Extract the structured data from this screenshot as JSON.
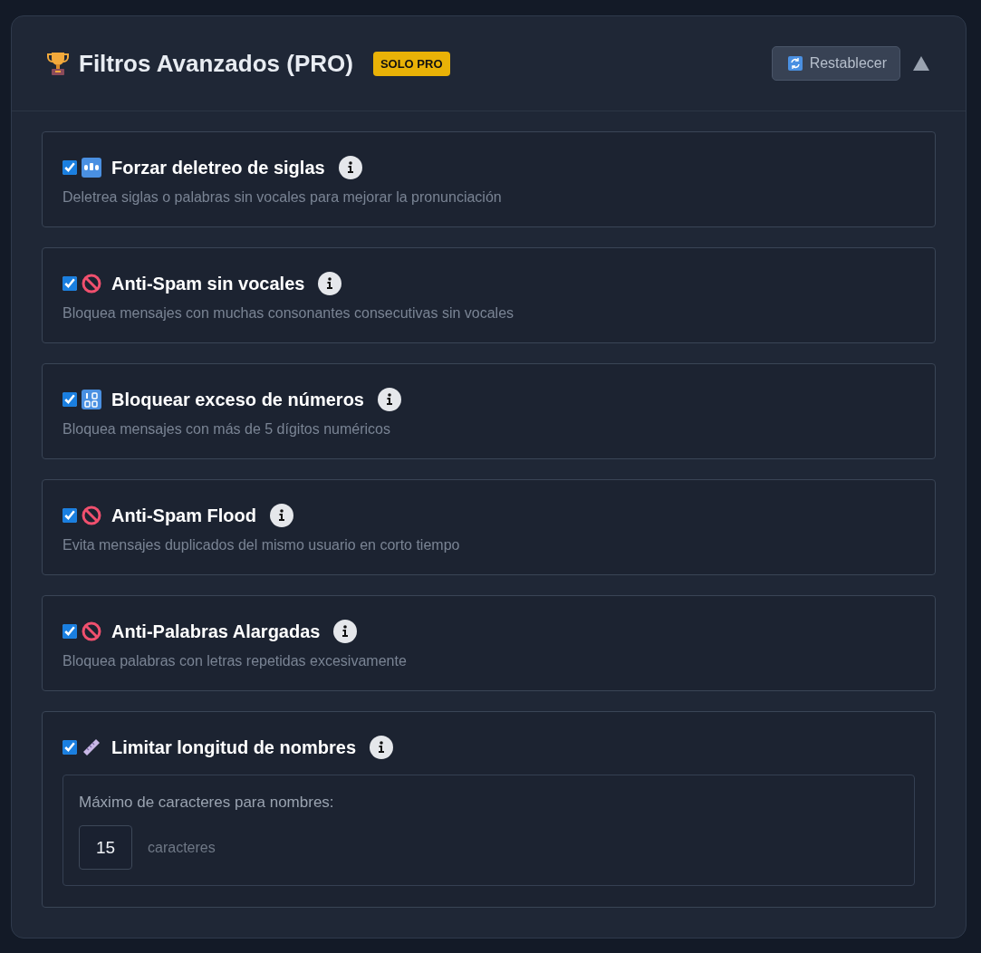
{
  "panel": {
    "title": "Filtros Avanzados (PRO)",
    "badge": "SOLO PRO",
    "reset_button": "Restablecer",
    "expanded": true
  },
  "filters": [
    {
      "kind": "letters",
      "title": "Forzar deletreo de siglas",
      "description": "Deletrea siglas o palabras sin vocales para mejorar la pronunciación",
      "checked": true
    },
    {
      "kind": "blocked",
      "title": "Anti-Spam sin vocales",
      "description": "Bloquea mensajes con muchas consonantes consecutivas sin vocales",
      "checked": true
    },
    {
      "kind": "numbers",
      "title": "Bloquear exceso de números",
      "description": "Bloquea mensajes con más de 5 dígitos numéricos",
      "checked": true
    },
    {
      "kind": "blocked",
      "title": "Anti-Spam Flood",
      "description": "Evita mensajes duplicados del mismo usuario en corto tiempo",
      "checked": true
    },
    {
      "kind": "blocked",
      "title": "Anti-Palabras Alargadas",
      "description": "Bloquea palabras con letras repetidas excesivamente",
      "checked": true
    },
    {
      "kind": "length",
      "title": "Limitar longitud de nombres",
      "checked": true,
      "setting": {
        "label": "Máximo de caracteres para nombres:",
        "value": "15",
        "unit": "caracteres"
      }
    }
  ]
}
